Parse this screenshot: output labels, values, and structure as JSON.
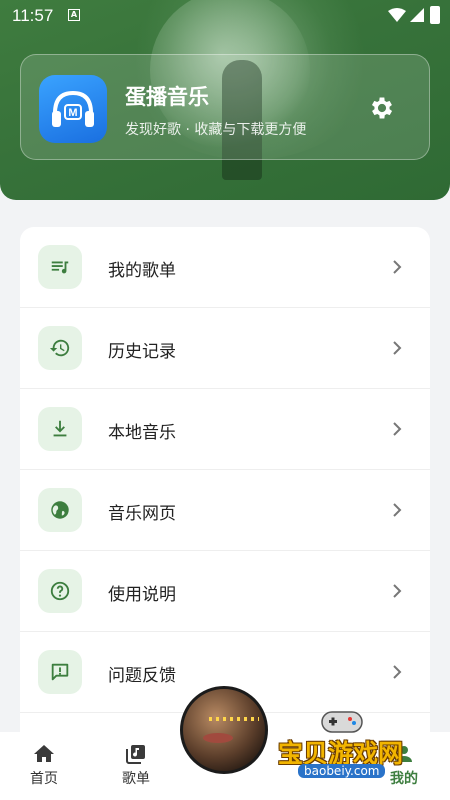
{
  "status_bar": {
    "time": "11:57",
    "notification_icon": "A"
  },
  "header": {
    "app_name": "蛋播音乐",
    "app_tagline": "发现好歌 · 收藏与下载更方便",
    "logo_letter": "M",
    "settings_icon": "gear-icon"
  },
  "menu": {
    "items": [
      {
        "label": "我的歌单",
        "icon": "playlist-icon"
      },
      {
        "label": "历史记录",
        "icon": "history-icon"
      },
      {
        "label": "本地音乐",
        "icon": "download-icon"
      },
      {
        "label": "音乐网页",
        "icon": "globe-icon"
      },
      {
        "label": "使用说明",
        "icon": "help-icon"
      },
      {
        "label": "问题反馈",
        "icon": "feedback-icon"
      }
    ]
  },
  "nav": {
    "items": [
      {
        "label": "首页",
        "icon": "home-icon"
      },
      {
        "label": "歌单",
        "icon": "songlist-icon"
      },
      {
        "label": "我的",
        "icon": "profile-icon"
      }
    ]
  },
  "watermark": {
    "text": "宝贝游戏网",
    "url": "baobeiy.com"
  },
  "colors": {
    "accent": "#3d7e3f",
    "icon_bg": "#e6f3e6",
    "card_bg": "#ffffff",
    "page_bg": "#f2f3f5"
  }
}
